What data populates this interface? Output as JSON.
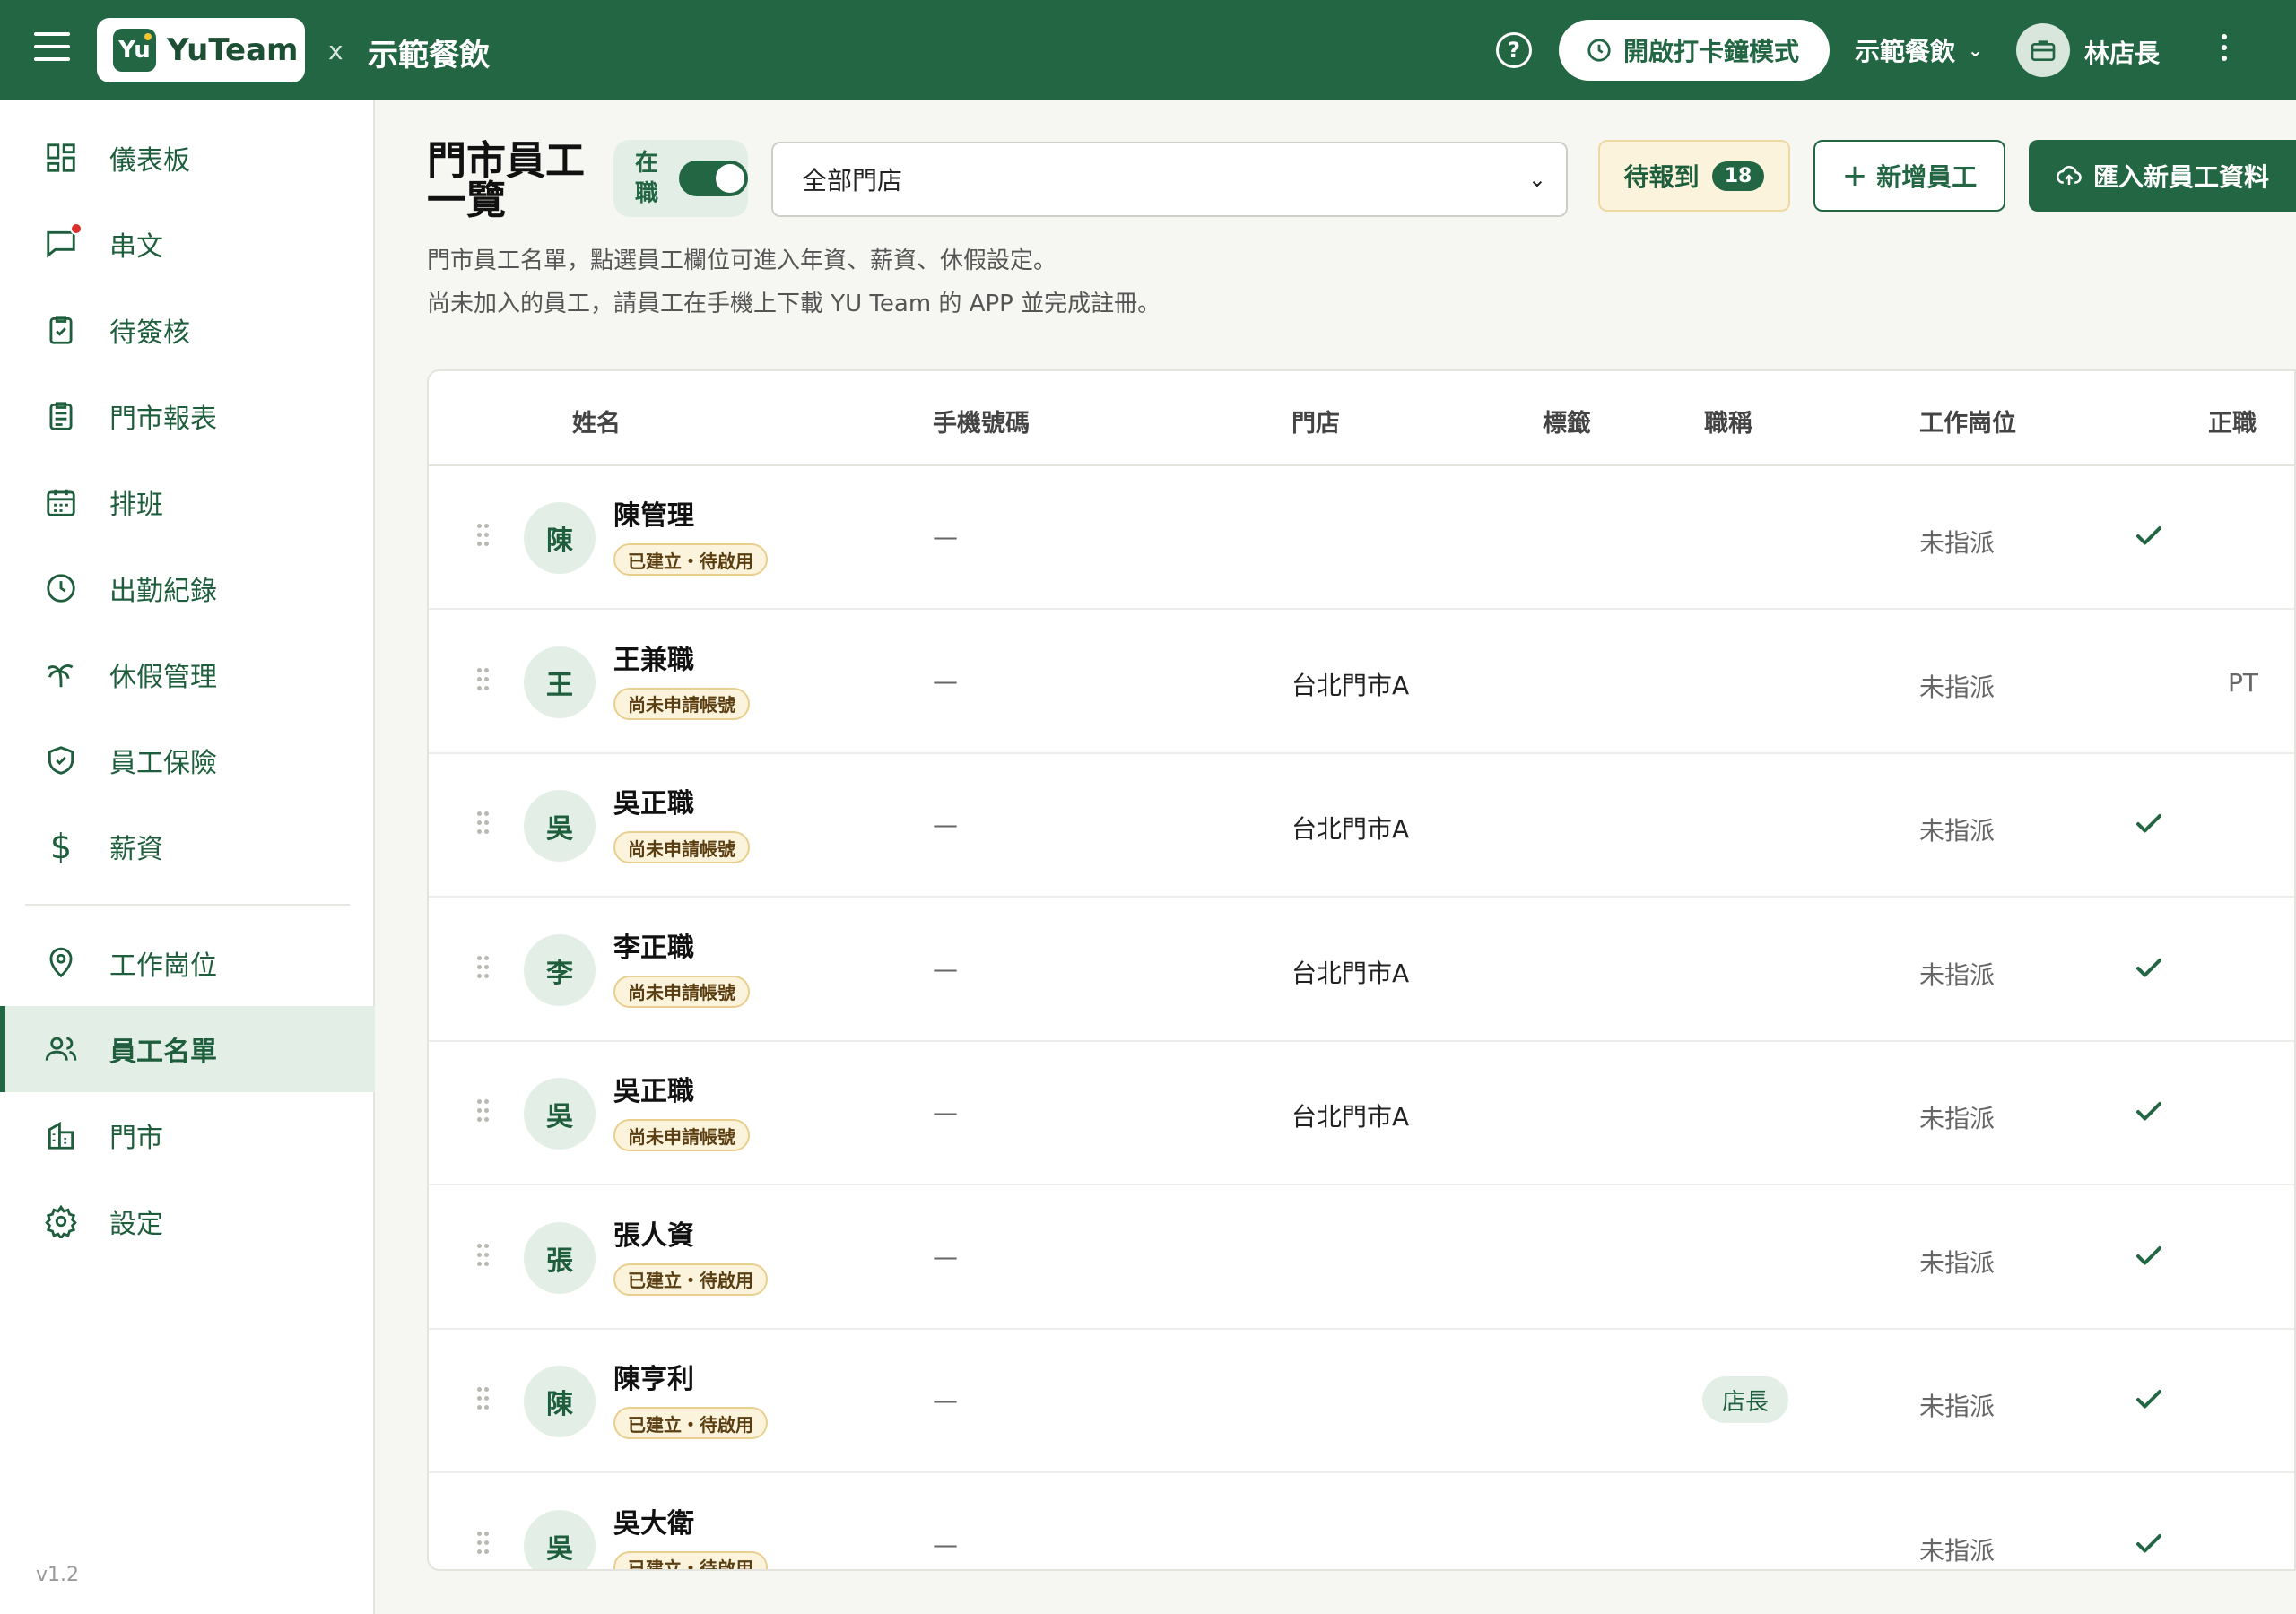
{
  "header": {
    "brand_badge": "Yu",
    "brand_name": "YuTeam",
    "separator": "x",
    "org_name": "示範餐飲",
    "clock_mode_button": "開啟打卡鐘模式",
    "store_selector": "示範餐飲",
    "user_name": "林店長"
  },
  "sidebar": {
    "items": [
      {
        "label": "儀表板",
        "icon": "dashboard-icon"
      },
      {
        "label": "串文",
        "icon": "chat-icon"
      },
      {
        "label": "待簽核",
        "icon": "clipboard-check-icon"
      },
      {
        "label": "門市報表",
        "icon": "report-icon"
      },
      {
        "label": "排班",
        "icon": "calendar-icon"
      },
      {
        "label": "出勤紀錄",
        "icon": "clock-icon"
      },
      {
        "label": "休假管理",
        "icon": "palm-tree-icon"
      },
      {
        "label": "員工保險",
        "icon": "shield-icon"
      },
      {
        "label": "薪資",
        "icon": "dollar-icon"
      },
      {
        "label": "工作崗位",
        "icon": "location-pin-icon"
      },
      {
        "label": "員工名單",
        "icon": "users-icon"
      },
      {
        "label": "門市",
        "icon": "building-icon"
      },
      {
        "label": "設定",
        "icon": "gear-icon"
      }
    ],
    "active": "員工名單",
    "version": "v1.2"
  },
  "page": {
    "title": "門市員工一覽",
    "toggle_label": "在職",
    "toggle_on": true,
    "store_filter": "全部門店",
    "pending_label": "待報到",
    "pending_count": "18",
    "add_button": "新增員工",
    "import_button": "匯入新員工資料",
    "description_1": "門市員工名單，點選員工欄位可進入年資、薪資、休假設定。",
    "description_2": "尚未加入的員工，請員工在手機上下載 YU Team 的 APP 並完成註冊。"
  },
  "table": {
    "columns": [
      "姓名",
      "手機號碼",
      "門店",
      "標籤",
      "職稱",
      "工作崗位",
      "正職"
    ],
    "rows": [
      {
        "initial": "陳",
        "name": "陳管理",
        "status": "已建立・待啟用",
        "phone": "—",
        "store": "",
        "tag": "",
        "title": "",
        "post": "未指派",
        "fulltime": "check"
      },
      {
        "initial": "王",
        "name": "王兼職",
        "status": "尚未申請帳號",
        "phone": "—",
        "store": "台北門市A",
        "tag": "",
        "title": "",
        "post": "未指派",
        "fulltime": "PT"
      },
      {
        "initial": "吳",
        "name": "吳正職",
        "status": "尚未申請帳號",
        "phone": "—",
        "store": "台北門市A",
        "tag": "",
        "title": "",
        "post": "未指派",
        "fulltime": "check"
      },
      {
        "initial": "李",
        "name": "李正職",
        "status": "尚未申請帳號",
        "phone": "—",
        "store": "台北門市A",
        "tag": "",
        "title": "",
        "post": "未指派",
        "fulltime": "check"
      },
      {
        "initial": "吳",
        "name": "吳正職",
        "status": "尚未申請帳號",
        "phone": "—",
        "store": "台北門市A",
        "tag": "",
        "title": "",
        "post": "未指派",
        "fulltime": "check"
      },
      {
        "initial": "張",
        "name": "張人資",
        "status": "已建立・待啟用",
        "phone": "—",
        "store": "",
        "tag": "",
        "title": "",
        "post": "未指派",
        "fulltime": "check"
      },
      {
        "initial": "陳",
        "name": "陳亨利",
        "status": "已建立・待啟用",
        "phone": "—",
        "store": "",
        "tag": "",
        "title": "店長",
        "post": "未指派",
        "fulltime": "check"
      },
      {
        "initial": "吳",
        "name": "吳大衛",
        "status": "已建立・待啟用",
        "phone": "—",
        "store": "",
        "tag": "",
        "title": "",
        "post": "未指派",
        "fulltime": "check"
      }
    ]
  },
  "colors": {
    "primary": "#236643",
    "primary_light": "#e3efe6",
    "pending_bg": "#fbf3dc",
    "alert_dot": "#d9302b"
  }
}
